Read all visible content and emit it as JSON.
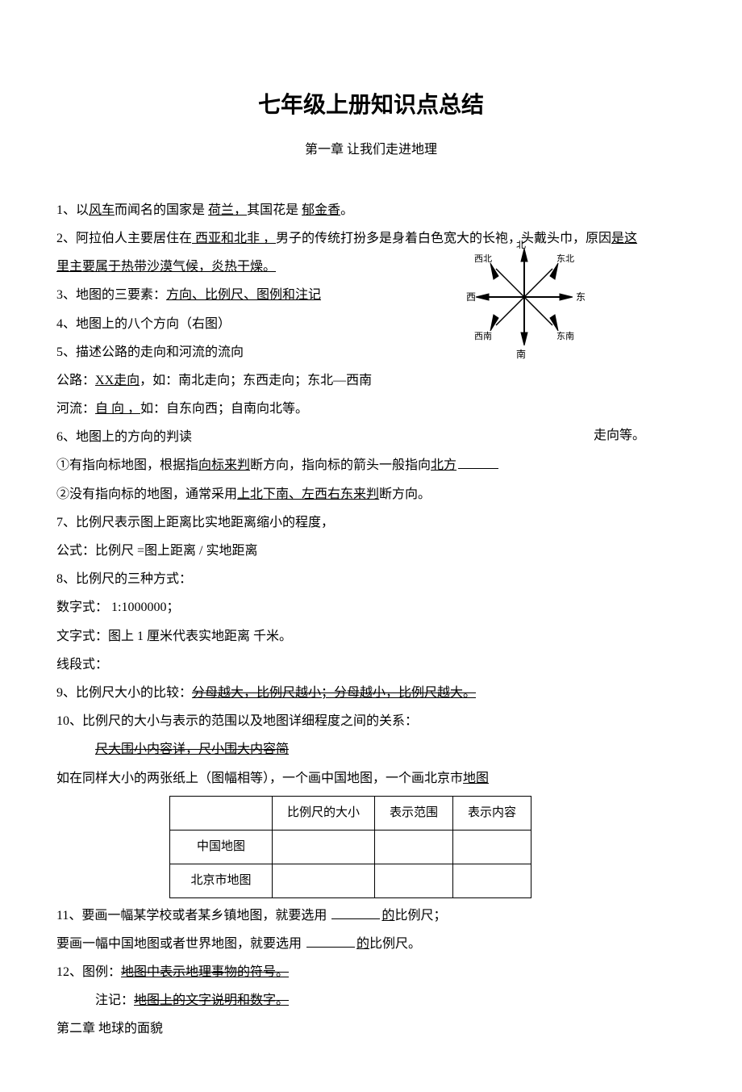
{
  "title": "七年级上册知识点总结",
  "subtitle": "第一章   让我们走进地理",
  "lines": {
    "l1_a": "1、以",
    "l1_u1": "风车",
    "l1_b": "而闻名的国家是  ",
    "l1_u2": "荷兰，",
    "l1_c": "其国花是  ",
    "l1_u3": "郁金香",
    "l1_d": "。",
    "l2_a": "2、阿拉伯人主要居住在",
    "l2_u1": "   西亚和北非   ，",
    "l2_b": "男子的传统打扮多是身着白色宽大的长袍，头戴头巾，原因",
    "l2_u2": "是这",
    "l2b_u": "里主要属于热带沙漠气候，炎热干燥。",
    "l3_a": "3、地图的三要素：",
    "l3_u": "方向、比例尺、图例和注记",
    "l4": "4、地图上的八个方向（右图）",
    "l5": "5、描述公路的走向和河流的流向",
    "l5b_a": "公路：",
    "l5b_u1": "XX走向",
    "l5b_b": "，如：南北走向；东西走向；东北—西南",
    "l5b_c": "走向等。",
    "l5c_a": "河流：",
    "l5c_u1": "自   向   ，",
    "l5c_b": "如：自东向西；自南向北等。",
    "l6": "6、地图上的方向的判读",
    "l6a_a": "①有指向标地图，根据指",
    "l6a_u": "向标来判",
    "l6a_b": "断方向，指向标的箭头一般指向",
    "l6a_u2": "北方",
    "l6b_a": "②没有指向标的地图，通常采用",
    "l6b_u": "上北下南、左西右东来判",
    "l6b_b": "断方向。",
    "l7": "7、比例尺表示图上距离比实地距离缩小的程度，",
    "l7b": "公式：比例尺 =图上距离  / 实地距离",
    "l8": "8、比例尺的三种方式：",
    "l8a": "数字式：   1:1000000；",
    "l8b": "文字式：图上   1 厘米代表实地距离           千米。",
    "l8c": "线段式：",
    "l9_a": "9、比例尺大小的比较：",
    "l9_su": "分母越大，比例尺越小；分母越小，比例尺越大。",
    "l10": "10、比例尺的大小与表示的范围以及地图详细程度之间的关系：",
    "l10b_su": "尺大围小内容详，尺小围大内容简",
    "l10c_a": "如在同样大小的两张纸上（图幅相等），一个画中国地图，一个画北京市",
    "l10c_u": "地图",
    "l11_a": "11、要画一幅某学校或者某乡镇地图，就要选用",
    "l11_u": "的",
    "l11_b": "比例尺；",
    "l11c_a": "要画一幅中国地图或者世界地图，就要选用",
    "l11c_u": "的",
    "l11c_b": "比例尺。",
    "l12_a": "12、图例：",
    "l12_su": "地图中表示地理事物的符号。",
    "l12b_a": "注记：",
    "l12b_su": "地图上的文字说明和数字。",
    "ch2": "第二章   地球的面貌"
  },
  "table": {
    "h0": "",
    "h1": "比例尺的大小",
    "h2": "表示范围",
    "h3": "表示内容",
    "r1": "中国地图",
    "r2": "北京市地图"
  },
  "compass": {
    "n": "北",
    "s": "南",
    "e": "东",
    "w": "西",
    "ne": "东北",
    "nw": "西北",
    "se": "东南",
    "sw": "西南"
  }
}
